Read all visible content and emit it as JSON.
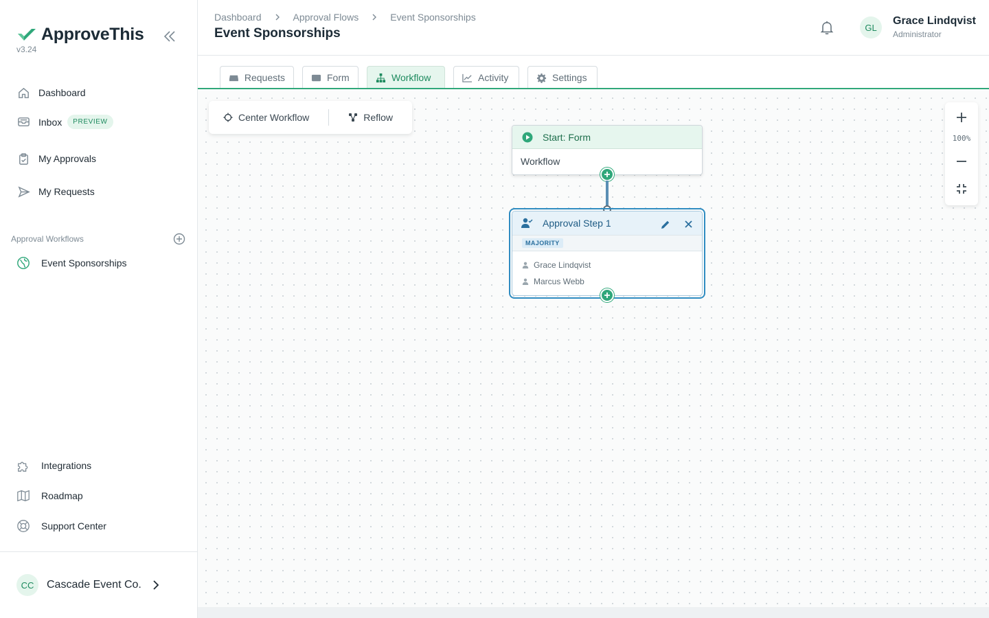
{
  "app": {
    "name": "ApproveThis",
    "version": "v3.24",
    "brand_color": "#2fa77a"
  },
  "sidebar": {
    "nav": [
      {
        "label": "Dashboard",
        "icon": "home-icon"
      },
      {
        "label": "Inbox",
        "icon": "inbox-icon",
        "badge": "PREVIEW"
      },
      {
        "label": "My Approvals",
        "icon": "clipboard-check-icon"
      },
      {
        "label": "My Requests",
        "icon": "send-icon"
      }
    ],
    "section_label": "Approval Workflows",
    "workflows": [
      {
        "label": "Event Sponsorships",
        "icon": "globe-icon"
      }
    ],
    "bottom": [
      {
        "label": "Integrations",
        "icon": "puzzle-icon"
      },
      {
        "label": "Roadmap",
        "icon": "map-icon"
      },
      {
        "label": "Support Center",
        "icon": "lifebuoy-icon"
      }
    ],
    "org": {
      "initials": "CC",
      "name": "Cascade Event Co."
    }
  },
  "header": {
    "breadcrumb": [
      "Dashboard",
      "Approval Flows",
      "Event Sponsorships"
    ],
    "title": "Event Sponsorships",
    "user": {
      "initials": "GL",
      "name": "Grace Lindqvist",
      "role": "Administrator"
    }
  },
  "tabs": [
    {
      "label": "Requests",
      "icon": "tray-icon"
    },
    {
      "label": "Form",
      "icon": "form-icon"
    },
    {
      "label": "Workflow",
      "icon": "sitemap-icon",
      "active": true
    },
    {
      "label": "Activity",
      "icon": "chart-line-icon"
    },
    {
      "label": "Settings",
      "icon": "gear-icon"
    }
  ],
  "canvas": {
    "toolbar": {
      "center_label": "Center Workflow",
      "reflow_label": "Reflow"
    },
    "zoom_level": "100%",
    "start_node": {
      "title": "Start: Form",
      "body": "Workflow"
    },
    "step_node": {
      "title": "Approval Step 1",
      "rule": "MAJORITY",
      "approvers": [
        "Grace Lindqvist",
        "Marcus Webb"
      ]
    }
  }
}
